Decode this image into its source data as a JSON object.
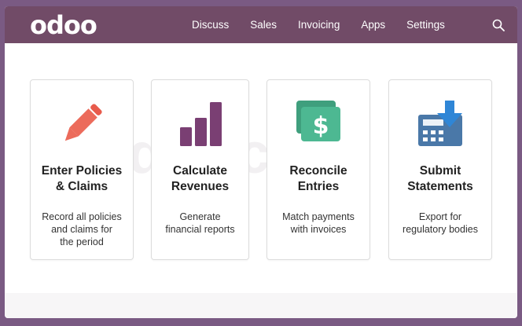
{
  "navbar": {
    "logo": "odoo",
    "menu": [
      "Discuss",
      "Sales",
      "Invoicing",
      "Apps",
      "Settings"
    ]
  },
  "watermark": "Sdic corp",
  "cards": [
    {
      "title_line1": "Enter Policies",
      "title_line2": "& Claims",
      "desc_line1": "Record all policies",
      "desc_line2": "and claims for",
      "desc_line3": "the period",
      "icon": "pencil-icon"
    },
    {
      "title_line1": "Calculate",
      "title_line2": "Revenues",
      "desc_line1": "Generate",
      "desc_line2": "financial reports",
      "desc_line3": "",
      "icon": "bar-chart-icon"
    },
    {
      "title_line1": "Reconcile",
      "title_line2": "Entries",
      "desc_line1": "Match payments",
      "desc_line2": "with invoices",
      "desc_line3": "",
      "icon": "money-icon"
    },
    {
      "title_line1": "Submit",
      "title_line2": "Statements",
      "desc_line1": "Export for",
      "desc_line2": "regulatory bodies",
      "desc_line3": "",
      "icon": "download-calculator-icon"
    }
  ],
  "colors": {
    "brand": "#714b67",
    "pencil": "#ec6b5b",
    "chart": "#7a3f73",
    "money": "#4db892",
    "submit": "#4a78a8",
    "arrow": "#2f86d6"
  }
}
